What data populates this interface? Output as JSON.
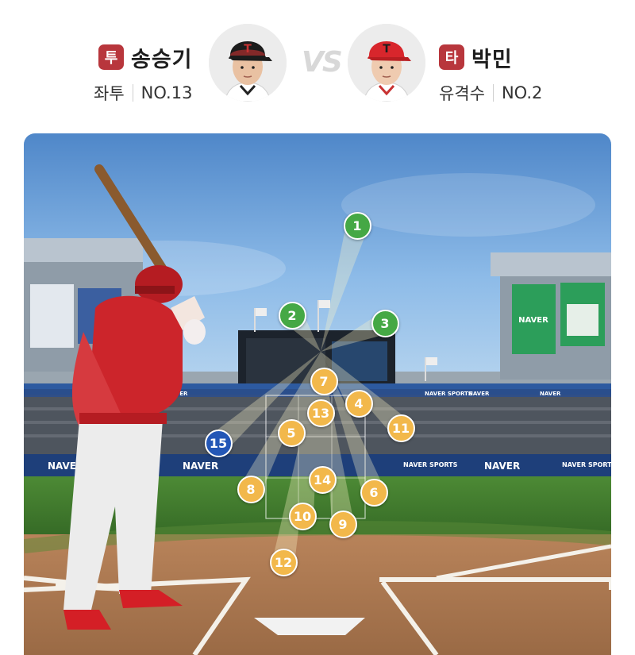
{
  "pitcher": {
    "badge": "투",
    "name": "송승기",
    "hand": "좌투",
    "number": "NO.13"
  },
  "batter": {
    "badge": "타",
    "name": "박민",
    "position": "유격수",
    "number": "NO.2"
  },
  "versus": "VS",
  "colors": {
    "badge": "#b8363c",
    "strike": "#f2b84b",
    "ball": "#45a845",
    "hit": "#2457b6",
    "sky": "#6fa6e0",
    "grass": "#3f7a2c"
  },
  "sponsor_boards": [
    "NAVER",
    "NAVER",
    "NAVER",
    "NAVER SPORTS",
    "NAVER",
    "NAVER SPORTS",
    "NAVER",
    "NAVER SPORTS",
    "NAVER"
  ],
  "pitches": [
    {
      "label": "1",
      "result": "ball"
    },
    {
      "label": "2",
      "result": "ball"
    },
    {
      "label": "3",
      "result": "ball"
    },
    {
      "label": "4",
      "result": "strike"
    },
    {
      "label": "5",
      "result": "strike"
    },
    {
      "label": "6",
      "result": "strike"
    },
    {
      "label": "7",
      "result": "strike"
    },
    {
      "label": "8",
      "result": "strike"
    },
    {
      "label": "9",
      "result": "strike"
    },
    {
      "label": "10",
      "result": "strike"
    },
    {
      "label": "11",
      "result": "strike"
    },
    {
      "label": "12",
      "result": "strike"
    },
    {
      "label": "13",
      "result": "strike"
    },
    {
      "label": "14",
      "result": "strike"
    },
    {
      "label": "15",
      "result": "hit"
    }
  ]
}
